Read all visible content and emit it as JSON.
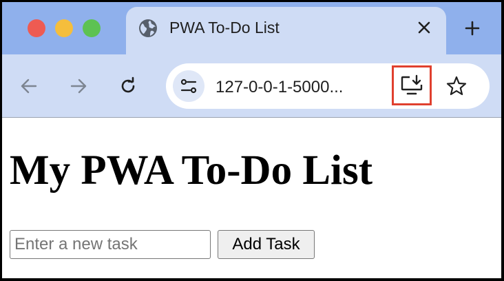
{
  "browser": {
    "tab": {
      "title": "PWA To-Do List",
      "favicon": "globe-icon"
    },
    "address_bar": {
      "url": "127-0-0-1-5000..."
    },
    "icons": {
      "back": "arrow-left-icon",
      "forward": "arrow-right-icon",
      "reload": "reload-icon",
      "site_info": "tune-icon",
      "install": "install-app-icon",
      "bookmark": "star-icon",
      "close_tab": "close-icon",
      "new_tab": "plus-icon"
    },
    "highlight_color": "#e0402e"
  },
  "page": {
    "heading": "My PWA To-Do List",
    "task_input": {
      "placeholder": "Enter a new task",
      "value": ""
    },
    "add_button_label": "Add Task"
  }
}
